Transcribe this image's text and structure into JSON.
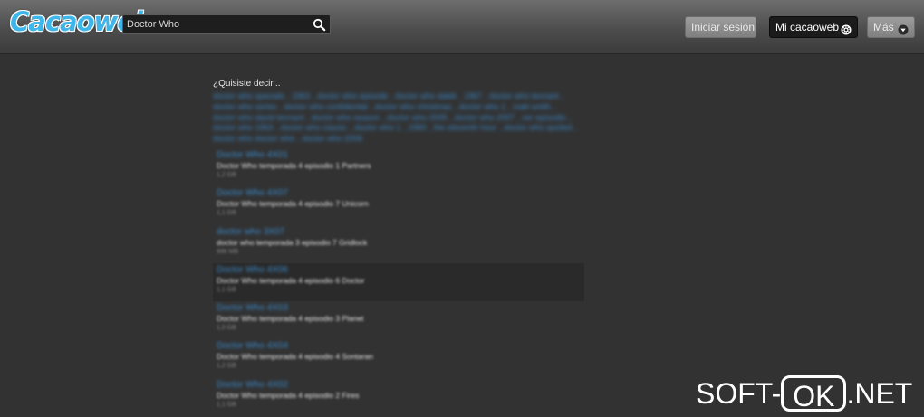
{
  "header": {
    "logo": "Cacaoweb",
    "search": {
      "value": "Doctor Who",
      "placeholder": ""
    },
    "buttons": {
      "login": "Iniciar sesión",
      "mi": "Mi cacaoweb",
      "mas": "Más"
    }
  },
  "main": {
    "did_you_mean": "¿Quisiste decir...",
    "suggestions": [
      "doctor who specials",
      "1963",
      "doctor who episode",
      "doctor who dalek",
      "1967",
      "doctor who tennant",
      "doctor who series",
      "doctor who confidential",
      "doctor who christmas",
      "doctor who 1",
      "matt smith",
      "doctor who david tennant",
      "doctor who season",
      "doctor who 2005",
      "doctor who 2007",
      "ver episodio",
      "doctor who 1963",
      "doctor who classic",
      "doctor who 1",
      "1960",
      "the eleventh hour",
      "doctor who spoiled",
      "doctor who doctor who",
      "doctor who 2006"
    ],
    "results": [
      {
        "title": "Doctor Who 4X01",
        "desc": "Doctor Who temporada 4 episodio 1 Partners",
        "meta": "1,2 GB"
      },
      {
        "title": "Doctor Who 4X07",
        "desc": "Doctor Who temporada 4 episodio 7 Unicorn",
        "meta": "1,1 GB"
      },
      {
        "title": "doctor who 3X07",
        "desc": "doctor who temporada 3 episodio 7 Gridlock",
        "meta": "996 MB"
      },
      {
        "title": "Doctor Who 4X06",
        "desc": "Doctor Who temporada 4 episodio 6 Doctor",
        "meta": "1,1 GB"
      },
      {
        "title": "Doctor Who 4X03",
        "desc": "Doctor Who temporada 4 episodio 3 Planet",
        "meta": "1,0 GB"
      },
      {
        "title": "Doctor Who 4X04",
        "desc": "Doctor Who temporada 4 episodio 4 Sontaran",
        "meta": "1,2 GB"
      },
      {
        "title": "Doctor Who 4X02",
        "desc": "Doctor Who temporada 4 episodio 2 Fires",
        "meta": "1,1 GB"
      }
    ]
  },
  "watermark": {
    "left": "SOFT-",
    "box": "OK",
    "right": ".NET"
  }
}
